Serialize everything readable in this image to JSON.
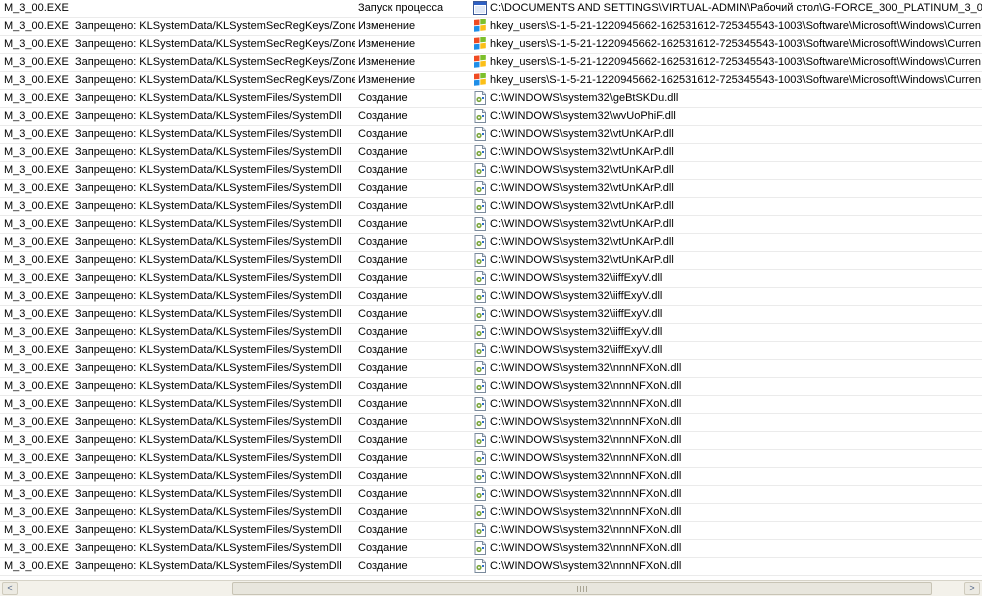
{
  "rows": [
    {
      "process": "M_3_00.EXE",
      "rule": "",
      "operation": "Запуск процесса",
      "icon": "window-icon",
      "path": "C:\\DOCUMENTS AND SETTINGS\\VIRTUAL-ADMIN\\Рабочий стол\\G-FORCE_300_PLATINUM_3_00.EXE"
    },
    {
      "process": "M_3_00.EXE",
      "rule": "Запрещено: KLSystemData/KLSystemSecRegKeys/Zones",
      "operation": "Изменение",
      "icon": "registry-icon",
      "path": "hkey_users\\S-1-5-21-1220945662-162531612-725345543-1003\\Software\\Microsoft\\Windows\\Curren"
    },
    {
      "process": "M_3_00.EXE",
      "rule": "Запрещено: KLSystemData/KLSystemSecRegKeys/Zones",
      "operation": "Изменение",
      "icon": "registry-icon",
      "path": "hkey_users\\S-1-5-21-1220945662-162531612-725345543-1003\\Software\\Microsoft\\Windows\\Curren"
    },
    {
      "process": "M_3_00.EXE",
      "rule": "Запрещено: KLSystemData/KLSystemSecRegKeys/Zones",
      "operation": "Изменение",
      "icon": "registry-icon",
      "path": "hkey_users\\S-1-5-21-1220945662-162531612-725345543-1003\\Software\\Microsoft\\Windows\\Curren"
    },
    {
      "process": "M_3_00.EXE",
      "rule": "Запрещено: KLSystemData/KLSystemSecRegKeys/Zones",
      "operation": "Изменение",
      "icon": "registry-icon",
      "path": "hkey_users\\S-1-5-21-1220945662-162531612-725345543-1003\\Software\\Microsoft\\Windows\\Curren"
    },
    {
      "process": "M_3_00.EXE",
      "rule": "Запрещено: KLSystemData/KLSystemFiles/SystemDll",
      "operation": "Создание",
      "icon": "dll-file-icon",
      "path": "C:\\WINDOWS\\system32\\geBtSKDu.dll"
    },
    {
      "process": "M_3_00.EXE",
      "rule": "Запрещено: KLSystemData/KLSystemFiles/SystemDll",
      "operation": "Создание",
      "icon": "dll-file-icon",
      "path": "C:\\WINDOWS\\system32\\wvUoPhiF.dll"
    },
    {
      "process": "M_3_00.EXE",
      "rule": "Запрещено: KLSystemData/KLSystemFiles/SystemDll",
      "operation": "Создание",
      "icon": "dll-file-icon",
      "path": "C:\\WINDOWS\\system32\\vtUnKArP.dll"
    },
    {
      "process": "M_3_00.EXE",
      "rule": "Запрещено: KLSystemData/KLSystemFiles/SystemDll",
      "operation": "Создание",
      "icon": "dll-file-icon",
      "path": "C:\\WINDOWS\\system32\\vtUnKArP.dll"
    },
    {
      "process": "M_3_00.EXE",
      "rule": "Запрещено: KLSystemData/KLSystemFiles/SystemDll",
      "operation": "Создание",
      "icon": "dll-file-icon",
      "path": "C:\\WINDOWS\\system32\\vtUnKArP.dll"
    },
    {
      "process": "M_3_00.EXE",
      "rule": "Запрещено: KLSystemData/KLSystemFiles/SystemDll",
      "operation": "Создание",
      "icon": "dll-file-icon",
      "path": "C:\\WINDOWS\\system32\\vtUnKArP.dll"
    },
    {
      "process": "M_3_00.EXE",
      "rule": "Запрещено: KLSystemData/KLSystemFiles/SystemDll",
      "operation": "Создание",
      "icon": "dll-file-icon",
      "path": "C:\\WINDOWS\\system32\\vtUnKArP.dll"
    },
    {
      "process": "M_3_00.EXE",
      "rule": "Запрещено: KLSystemData/KLSystemFiles/SystemDll",
      "operation": "Создание",
      "icon": "dll-file-icon",
      "path": "C:\\WINDOWS\\system32\\vtUnKArP.dll"
    },
    {
      "process": "M_3_00.EXE",
      "rule": "Запрещено: KLSystemData/KLSystemFiles/SystemDll",
      "operation": "Создание",
      "icon": "dll-file-icon",
      "path": "C:\\WINDOWS\\system32\\vtUnKArP.dll"
    },
    {
      "process": "M_3_00.EXE",
      "rule": "Запрещено: KLSystemData/KLSystemFiles/SystemDll",
      "operation": "Создание",
      "icon": "dll-file-icon",
      "path": "C:\\WINDOWS\\system32\\vtUnKArP.dll"
    },
    {
      "process": "M_3_00.EXE",
      "rule": "Запрещено: KLSystemData/KLSystemFiles/SystemDll",
      "operation": "Создание",
      "icon": "dll-file-icon",
      "path": "C:\\WINDOWS\\system32\\iiffExyV.dll"
    },
    {
      "process": "M_3_00.EXE",
      "rule": "Запрещено: KLSystemData/KLSystemFiles/SystemDll",
      "operation": "Создание",
      "icon": "dll-file-icon",
      "path": "C:\\WINDOWS\\system32\\iiffExyV.dll"
    },
    {
      "process": "M_3_00.EXE",
      "rule": "Запрещено: KLSystemData/KLSystemFiles/SystemDll",
      "operation": "Создание",
      "icon": "dll-file-icon",
      "path": "C:\\WINDOWS\\system32\\iiffExyV.dll"
    },
    {
      "process": "M_3_00.EXE",
      "rule": "Запрещено: KLSystemData/KLSystemFiles/SystemDll",
      "operation": "Создание",
      "icon": "dll-file-icon",
      "path": "C:\\WINDOWS\\system32\\iiffExyV.dll"
    },
    {
      "process": "M_3_00.EXE",
      "rule": "Запрещено: KLSystemData/KLSystemFiles/SystemDll",
      "operation": "Создание",
      "icon": "dll-file-icon",
      "path": "C:\\WINDOWS\\system32\\iiffExyV.dll"
    },
    {
      "process": "M_3_00.EXE",
      "rule": "Запрещено: KLSystemData/KLSystemFiles/SystemDll",
      "operation": "Создание",
      "icon": "dll-file-icon",
      "path": "C:\\WINDOWS\\system32\\nnnNFXoN.dll"
    },
    {
      "process": "M_3_00.EXE",
      "rule": "Запрещено: KLSystemData/KLSystemFiles/SystemDll",
      "operation": "Создание",
      "icon": "dll-file-icon",
      "path": "C:\\WINDOWS\\system32\\nnnNFXoN.dll"
    },
    {
      "process": "M_3_00.EXE",
      "rule": "Запрещено: KLSystemData/KLSystemFiles/SystemDll",
      "operation": "Создание",
      "icon": "dll-file-icon",
      "path": "C:\\WINDOWS\\system32\\nnnNFXoN.dll"
    },
    {
      "process": "M_3_00.EXE",
      "rule": "Запрещено: KLSystemData/KLSystemFiles/SystemDll",
      "operation": "Создание",
      "icon": "dll-file-icon",
      "path": "C:\\WINDOWS\\system32\\nnnNFXoN.dll"
    },
    {
      "process": "M_3_00.EXE",
      "rule": "Запрещено: KLSystemData/KLSystemFiles/SystemDll",
      "operation": "Создание",
      "icon": "dll-file-icon",
      "path": "C:\\WINDOWS\\system32\\nnnNFXoN.dll"
    },
    {
      "process": "M_3_00.EXE",
      "rule": "Запрещено: KLSystemData/KLSystemFiles/SystemDll",
      "operation": "Создание",
      "icon": "dll-file-icon",
      "path": "C:\\WINDOWS\\system32\\nnnNFXoN.dll"
    },
    {
      "process": "M_3_00.EXE",
      "rule": "Запрещено: KLSystemData/KLSystemFiles/SystemDll",
      "operation": "Создание",
      "icon": "dll-file-icon",
      "path": "C:\\WINDOWS\\system32\\nnnNFXoN.dll"
    },
    {
      "process": "M_3_00.EXE",
      "rule": "Запрещено: KLSystemData/KLSystemFiles/SystemDll",
      "operation": "Создание",
      "icon": "dll-file-icon",
      "path": "C:\\WINDOWS\\system32\\nnnNFXoN.dll"
    },
    {
      "process": "M_3_00.EXE",
      "rule": "Запрещено: KLSystemData/KLSystemFiles/SystemDll",
      "operation": "Создание",
      "icon": "dll-file-icon",
      "path": "C:\\WINDOWS\\system32\\nnnNFXoN.dll"
    },
    {
      "process": "M_3_00.EXE",
      "rule": "Запрещено: KLSystemData/KLSystemFiles/SystemDll",
      "operation": "Создание",
      "icon": "dll-file-icon",
      "path": "C:\\WINDOWS\\system32\\nnnNFXoN.dll"
    },
    {
      "process": "M_3_00.EXE",
      "rule": "Запрещено: KLSystemData/KLSystemFiles/SystemDll",
      "operation": "Создание",
      "icon": "dll-file-icon",
      "path": "C:\\WINDOWS\\system32\\nnnNFXoN.dll"
    },
    {
      "process": "M_3_00.EXE",
      "rule": "Запрещено: KLSystemData/KLSystemFiles/SystemDll",
      "operation": "Создание",
      "icon": "dll-file-icon",
      "path": "C:\\WINDOWS\\system32\\nnnNFXoN.dll"
    }
  ],
  "scrollbar": {
    "left_arrow": "<",
    "right_arrow": ">",
    "thumb_position": 0.24
  }
}
